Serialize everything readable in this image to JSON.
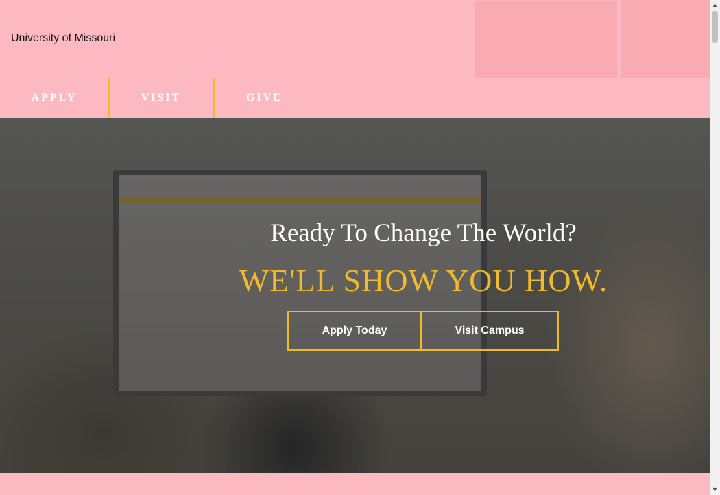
{
  "header": {
    "logo_alt": "University of Missouri"
  },
  "nav": {
    "apply": "APPLY",
    "visit": "VISIT",
    "give": "GIVE"
  },
  "hero": {
    "title": "Ready To Change The World?",
    "subtitle": "WE'LL SHOW YOU HOW.",
    "apply_button": "Apply Today",
    "visit_button": "Visit Campus"
  },
  "colors": {
    "background_pink": "#fcb9c2",
    "accent_gold": "#f1b92e"
  },
  "scrollbar": {
    "up_icon": "triangle-up-icon",
    "down_icon": "triangle-down-icon"
  }
}
